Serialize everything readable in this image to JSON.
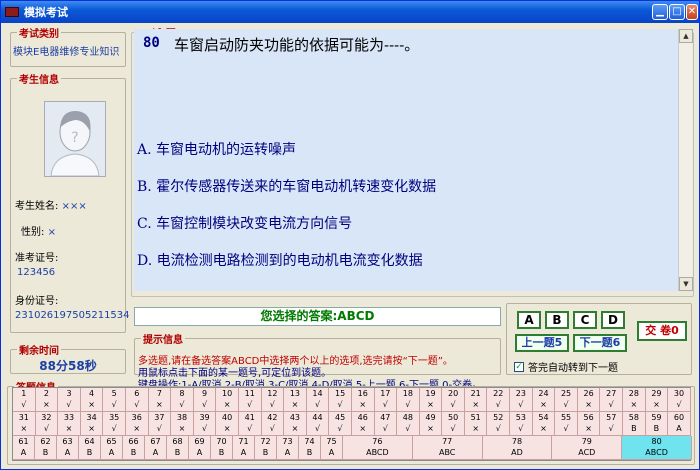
{
  "window": {
    "title": "模拟考试"
  },
  "category": {
    "legend": "考试类别",
    "value": "模块E电器维修专业知识"
  },
  "candidate": {
    "legend": "考生信息",
    "name_label": "考生姓名:",
    "name_value": "×××",
    "gender_label": "性别:",
    "gender_value": "×",
    "ticket_label": "准考证号:",
    "ticket_value": "123456",
    "id_label": "身份证号:",
    "id_value": "231026197505211534"
  },
  "timer": {
    "legend": "剩余时间",
    "value": "88分58秒"
  },
  "question": {
    "legend": "试 题",
    "number": "80",
    "text": "车窗启动防夹功能的依据可能为----。",
    "options": [
      "A. 车窗电动机的运转噪声",
      "B. 霍尔传感器传送来的车窗电动机转速变化数据",
      "C. 车窗控制模块改变电流方向信号",
      "D. 电流检测电路检测到的电动机电流变化数据"
    ]
  },
  "answer": {
    "text": "您选择的答案:ABCD"
  },
  "hints": {
    "legend": "提示信息",
    "line1": "多选题,请在备选答案ABCD中选择两个以上的选项,选完请按“下一题”。",
    "line2": "用鼠标点击下面的某一题号,可定位到该题。",
    "line3": "键盘操作:1-A/取消,2-B/取消,3-C/取消,4-D/取消,5-上一题,6-下一题,0-交卷。"
  },
  "controls": {
    "choices": [
      "A",
      "B",
      "C",
      "D"
    ],
    "prev": "上一题5",
    "next": "下一题6",
    "submit": "交 卷0",
    "auto_next": "答完自动转到下一题",
    "auto_next_checked": true
  },
  "grid": {
    "legend": "答题信息",
    "row1": [
      [
        "1",
        "√"
      ],
      [
        "2",
        "×"
      ],
      [
        "3",
        "√"
      ],
      [
        "4",
        "×"
      ],
      [
        "5",
        "√"
      ],
      [
        "6",
        "√"
      ],
      [
        "7",
        "×"
      ],
      [
        "8",
        "√"
      ],
      [
        "9",
        "√"
      ],
      [
        "10",
        "×"
      ],
      [
        "11",
        "√"
      ],
      [
        "12",
        "√"
      ],
      [
        "13",
        "×"
      ],
      [
        "14",
        "√"
      ],
      [
        "15",
        "√"
      ],
      [
        "16",
        "×"
      ],
      [
        "17",
        "√"
      ],
      [
        "18",
        "√"
      ],
      [
        "19",
        "×"
      ],
      [
        "20",
        "√"
      ],
      [
        "21",
        "×"
      ],
      [
        "22",
        "√"
      ],
      [
        "23",
        "√"
      ],
      [
        "24",
        "×"
      ],
      [
        "25",
        "√"
      ],
      [
        "26",
        "×"
      ],
      [
        "27",
        "√"
      ],
      [
        "28",
        "×"
      ],
      [
        "29",
        "×"
      ],
      [
        "30",
        "√"
      ]
    ],
    "row2": [
      [
        "31",
        "×"
      ],
      [
        "32",
        "√"
      ],
      [
        "33",
        "×"
      ],
      [
        "34",
        "×"
      ],
      [
        "35",
        "√"
      ],
      [
        "36",
        "×"
      ],
      [
        "37",
        "√"
      ],
      [
        "38",
        "×"
      ],
      [
        "39",
        "√"
      ],
      [
        "40",
        "×"
      ],
      [
        "41",
        "√"
      ],
      [
        "42",
        "√"
      ],
      [
        "43",
        "×"
      ],
      [
        "44",
        "√"
      ],
      [
        "45",
        "√"
      ],
      [
        "46",
        "×"
      ],
      [
        "47",
        "√"
      ],
      [
        "48",
        "√"
      ],
      [
        "49",
        "×"
      ],
      [
        "50",
        "√"
      ],
      [
        "51",
        "×"
      ],
      [
        "52",
        "√"
      ],
      [
        "53",
        "√"
      ],
      [
        "54",
        "×"
      ],
      [
        "55",
        "√"
      ],
      [
        "56",
        "×"
      ],
      [
        "57",
        "√"
      ],
      [
        "58",
        "B"
      ],
      [
        "59",
        "B"
      ],
      [
        "60",
        "A"
      ]
    ],
    "row3": [
      [
        "61",
        "A"
      ],
      [
        "62",
        "B"
      ],
      [
        "63",
        "A"
      ],
      [
        "64",
        "B"
      ],
      [
        "65",
        "A"
      ],
      [
        "66",
        "B"
      ],
      [
        "67",
        "A"
      ],
      [
        "68",
        "B"
      ],
      [
        "69",
        "A"
      ],
      [
        "70",
        "B"
      ],
      [
        "71",
        "A"
      ],
      [
        "72",
        "B"
      ],
      [
        "73",
        "A"
      ],
      [
        "74",
        "B"
      ],
      [
        "75",
        "A"
      ],
      [
        "76",
        "ABCD"
      ],
      [
        "77",
        "ABC"
      ],
      [
        "78",
        "AD"
      ],
      [
        "79",
        "ACD"
      ],
      [
        "80",
        "ABCD"
      ]
    ]
  }
}
